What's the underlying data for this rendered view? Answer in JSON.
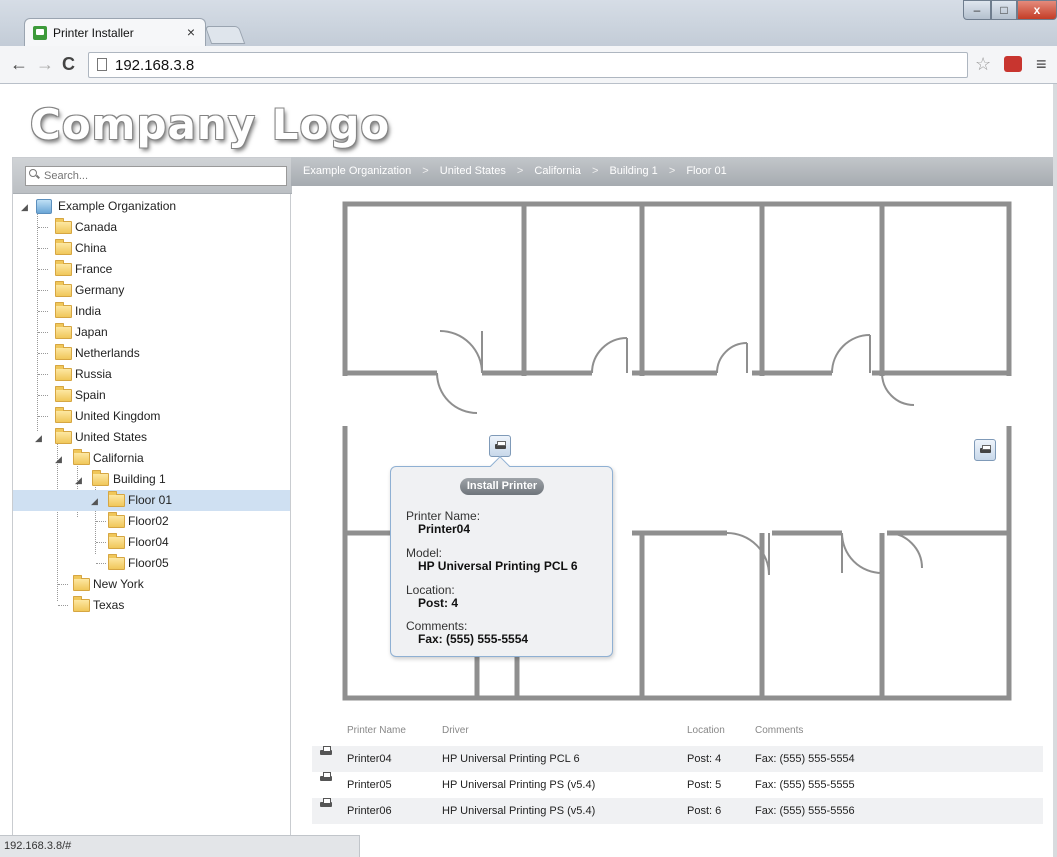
{
  "browser": {
    "tab_title": "Printer Installer",
    "tab_close": "×",
    "url": "192.168.3.8",
    "back": "←",
    "forward": "→",
    "reload": "C",
    "star": "☆",
    "menu": "≡",
    "window": {
      "minimize": "–",
      "maximize": "□",
      "close": "x"
    }
  },
  "logo": "Company Logo",
  "sidebar": {
    "search_placeholder": "Search...",
    "root": "Example Organization",
    "countries": [
      "Canada",
      "China",
      "France",
      "Germany",
      "India",
      "Japan",
      "Netherlands",
      "Russia",
      "Spain",
      "United Kingdom",
      "United States"
    ],
    "states": [
      "California",
      "New York",
      "Texas"
    ],
    "building": "Building 1",
    "floors": [
      "Floor 01",
      "Floor02",
      "Floor04",
      "Floor05"
    ],
    "selected": "Floor 01"
  },
  "breadcrumb": {
    "items": [
      "Example Organization",
      "United States",
      "California",
      "Building 1",
      "Floor 01"
    ],
    "separator": ">"
  },
  "popup": {
    "install_label": "Install Printer",
    "name_label": "Printer Name:",
    "name_value": "Printer04",
    "model_label": "Model:",
    "model_value": "HP Universal Printing PCL 6",
    "location_label": "Location:",
    "location_value": "Post: 4",
    "comments_label": "Comments:",
    "comments_value": "Fax: (555) 555-5554"
  },
  "table": {
    "headers": {
      "name": "Printer Name",
      "driver": "Driver",
      "location": "Location",
      "comments": "Comments"
    },
    "rows": [
      {
        "name": "Printer04",
        "driver": "HP Universal Printing PCL 6",
        "location": "Post: 4",
        "comments": "Fax: (555) 555-5554"
      },
      {
        "name": "Printer05",
        "driver": "HP Universal Printing PS (v5.4)",
        "location": "Post: 5",
        "comments": "Fax: (555) 555-5555"
      },
      {
        "name": "Printer06",
        "driver": "HP Universal Printing PS (v5.4)",
        "location": "Post: 6",
        "comments": "Fax: (555) 555-5556"
      }
    ]
  },
  "status_url": "192.168.3.8/#",
  "colors": {
    "selection": "#cfe0f2",
    "breadcrumb_bar": "#b3b7bb",
    "wall": "#8f8f8f",
    "popup_border": "#8fb0d3"
  }
}
